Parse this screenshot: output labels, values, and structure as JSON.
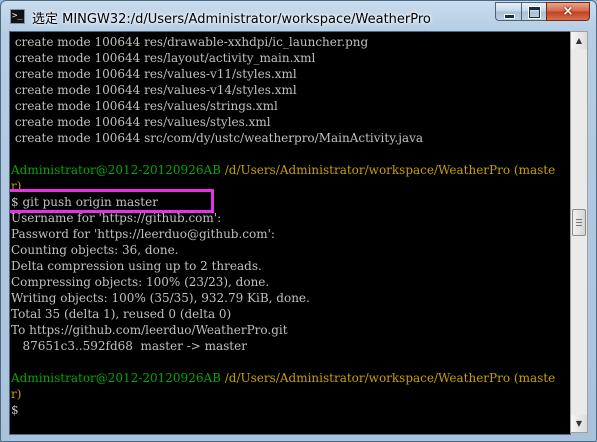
{
  "window": {
    "app_icon": "terminal-icon",
    "title": "选定 MINGW32:/d/Users/Administrator/workspace/WeatherPro",
    "buttons": {
      "minimize": "minimize",
      "maximize": "maximize",
      "close": "×"
    }
  },
  "console": {
    "lines": [
      {
        "text": " create mode 100644 res/drawable-xxhdpi/ic_launcher.png"
      },
      {
        "text": " create mode 100644 res/layout/activity_main.xml"
      },
      {
        "text": " create mode 100644 res/values-v11/styles.xml"
      },
      {
        "text": " create mode 100644 res/values-v14/styles.xml"
      },
      {
        "text": " create mode 100644 res/values/strings.xml"
      },
      {
        "text": " create mode 100644 res/values/styles.xml"
      },
      {
        "text": " create mode 100644 src/com/dy/ustc/weatherpro/MainActivity.java"
      },
      {
        "text": ""
      },
      {
        "user": "Administrator@2012-20120926AB",
        "path": " /d/Users/Administrator/workspace/WeatherPro (maste"
      },
      {
        "path_cont": "r)"
      },
      {
        "text": "$ git push origin master"
      },
      {
        "text": "Username for 'https://github.com':"
      },
      {
        "text": "Password for 'https://leerduo@github.com':"
      },
      {
        "text": "Counting objects: 36, done."
      },
      {
        "text": "Delta compression using up to 2 threads."
      },
      {
        "text": "Compressing objects: 100% (23/23), done."
      },
      {
        "text": "Writing objects: 100% (35/35), 932.79 KiB, done."
      },
      {
        "text": "Total 35 (delta 1), reused 0 (delta 0)"
      },
      {
        "text": "To https://github.com/leerduo/WeatherPro.git"
      },
      {
        "text": "   87651c3..592fd68  master -> master"
      },
      {
        "text": ""
      },
      {
        "user": "Administrator@2012-20120926AB",
        "path": " /d/Users/Administrator/workspace/WeatherPro (maste"
      },
      {
        "path_cont": "r)"
      },
      {
        "text": "$"
      }
    ]
  },
  "annotation": {
    "color": "#e830e8"
  },
  "scrollbar": {
    "up": "▲",
    "down": "▼"
  }
}
